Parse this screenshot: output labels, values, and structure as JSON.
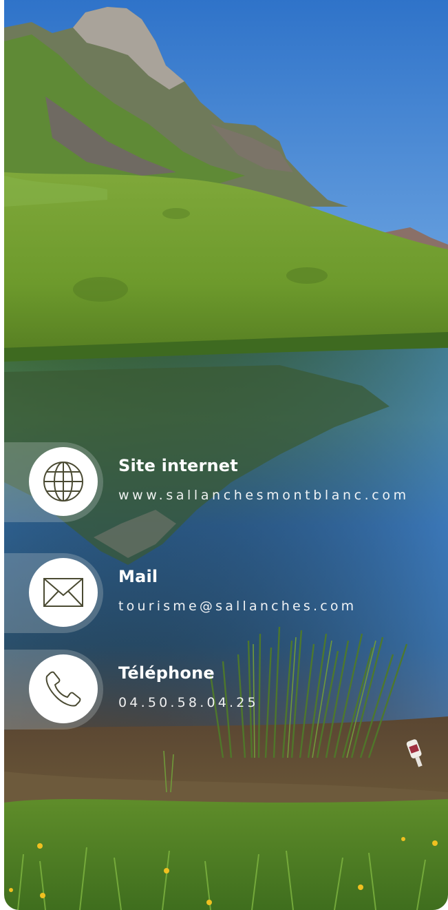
{
  "contacts": [
    {
      "label": "Site internet",
      "value": "www.sallanchesmontblanc.com",
      "icon": "globe-icon"
    },
    {
      "label": "Mail",
      "value": "tourisme@sallanches.com",
      "icon": "envelope-icon"
    },
    {
      "label": "Téléphone",
      "value": "04.50.58.04.25",
      "icon": "phone-icon"
    }
  ],
  "colors": {
    "icon_stroke": "#4a4a32",
    "text": "#ffffff",
    "sky_top": "#3f7fd0",
    "grass": "#6f9a2e",
    "water": "#2f5a80"
  }
}
